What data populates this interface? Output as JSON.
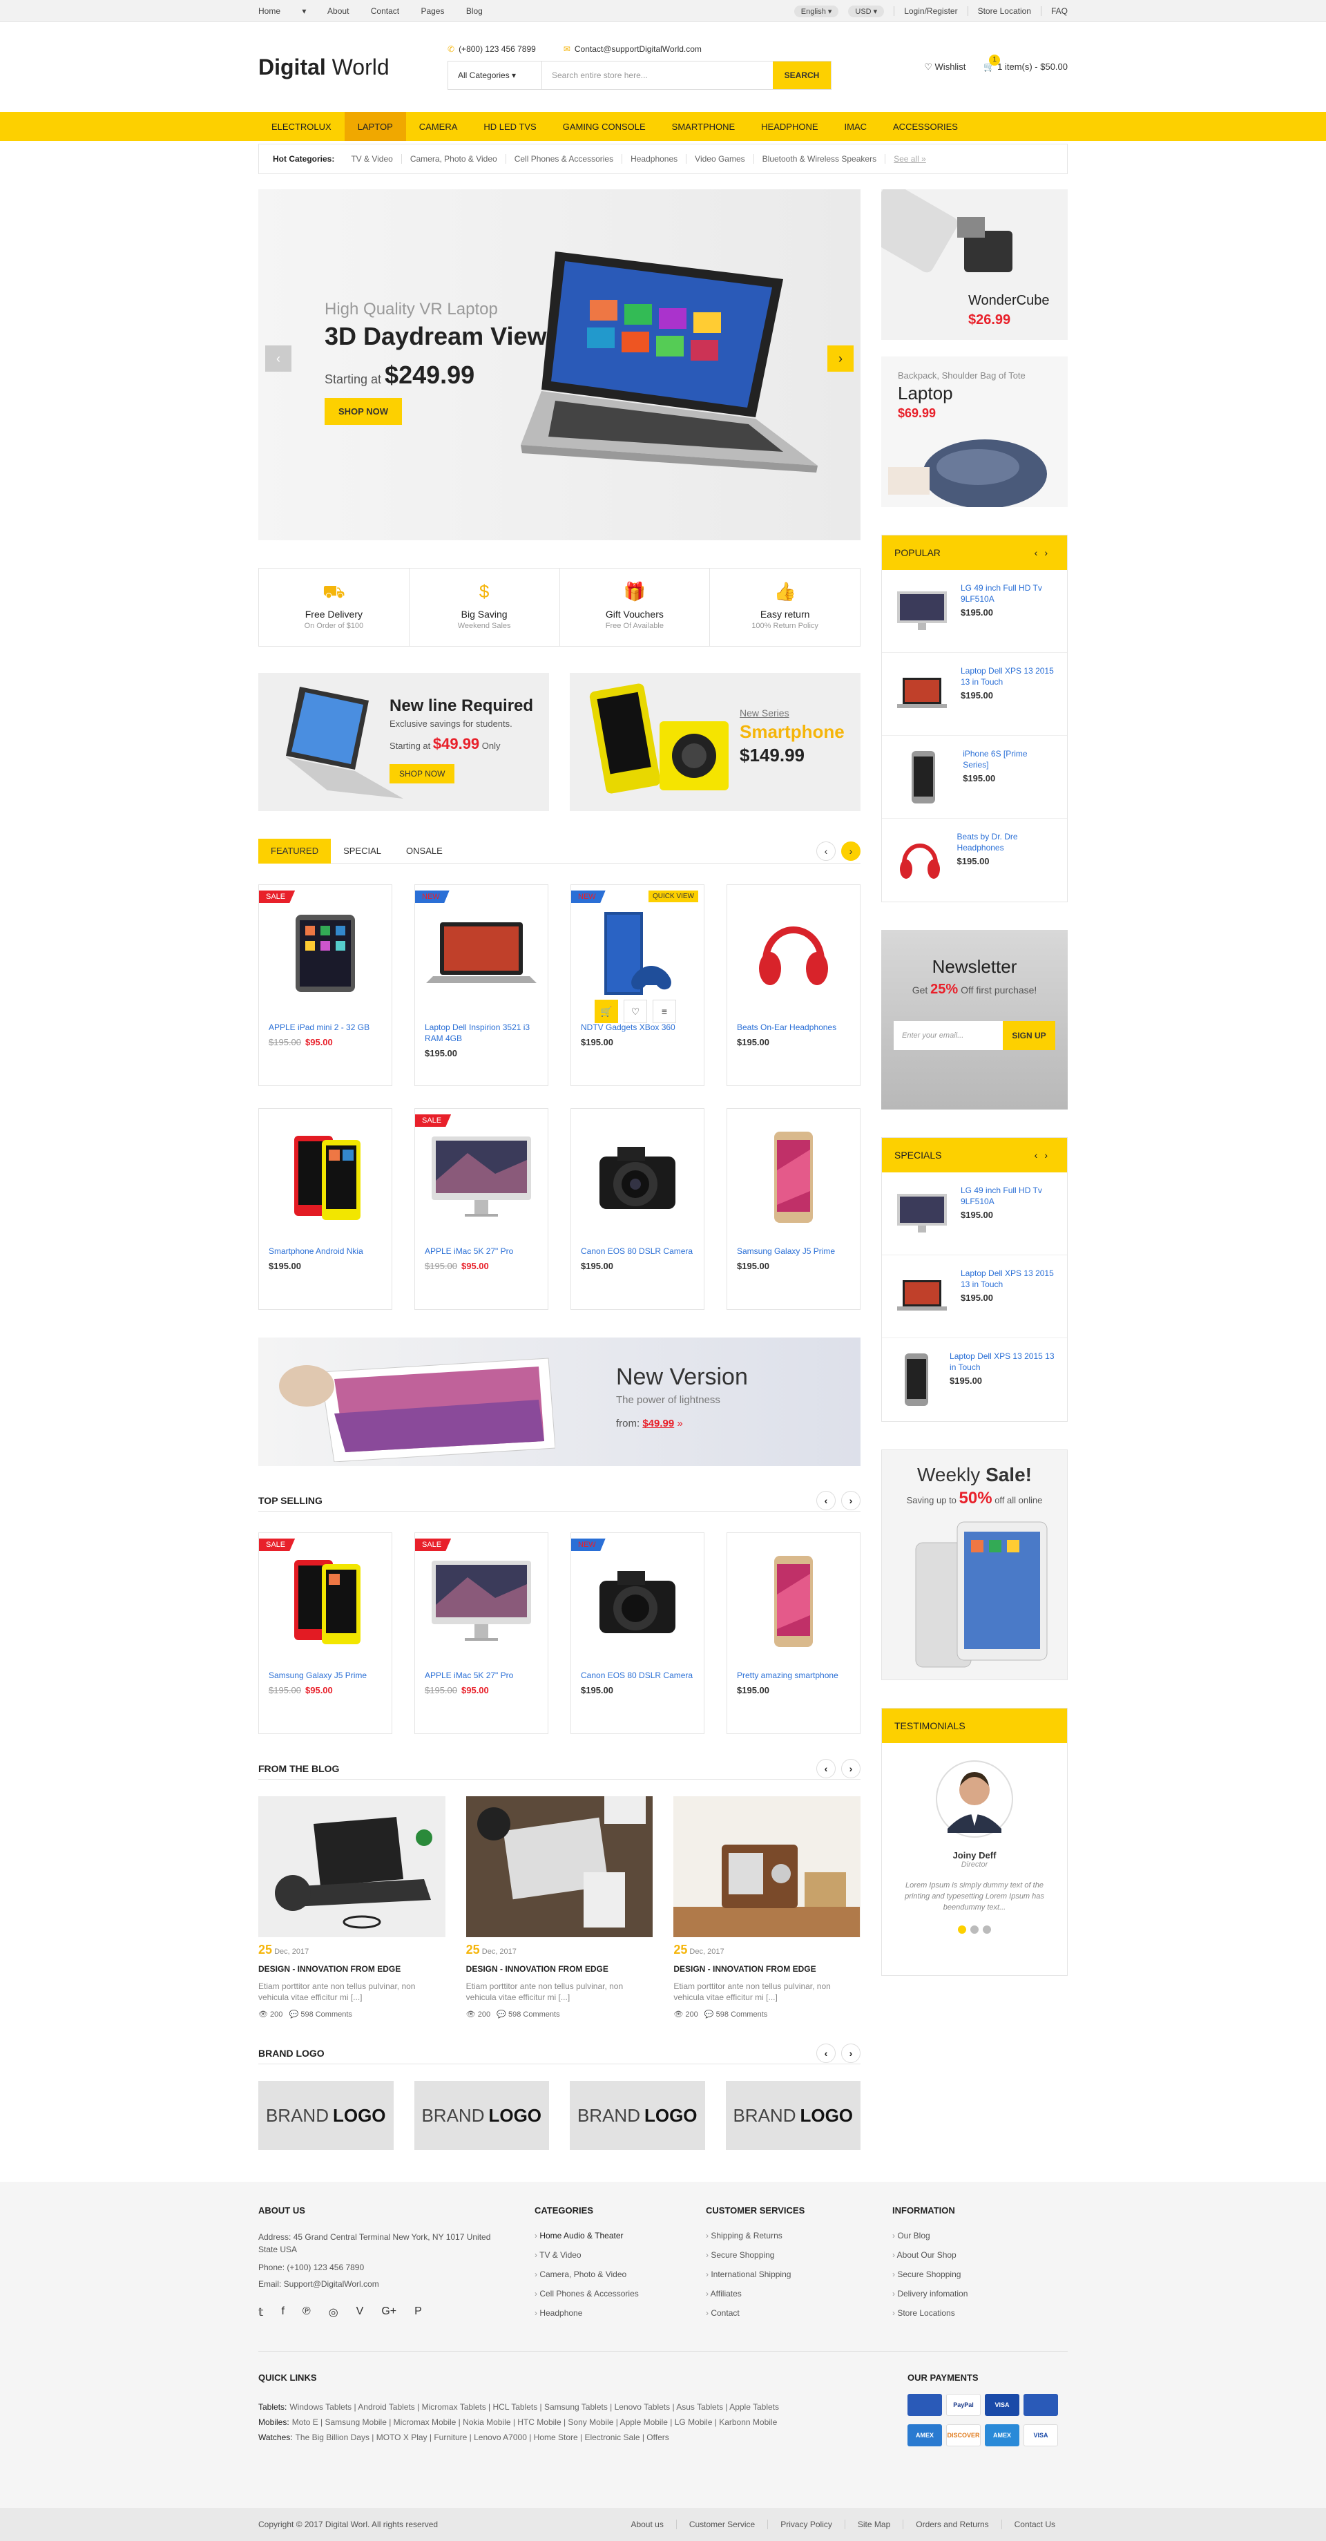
{
  "topbar": {
    "home": "Home",
    "about": "About",
    "contact": "Contact",
    "pages": "Pages",
    "blog": "Blog",
    "language": "English",
    "currency": "USD",
    "login": "Login/Register",
    "store": "Store Location",
    "faq": "FAQ"
  },
  "header": {
    "logo_bold": "Digital",
    "logo_light": " World",
    "phone": "(+800) 123 456 7899",
    "email": "Contact@supportDigitalWorld.com",
    "category": "All Categories",
    "search_placeholder": "Search entire store here...",
    "search_button": "SEARCH",
    "wishlist": "Wishlist",
    "cart_count": "1",
    "cart": "1 item(s) - $50.00"
  },
  "nav": [
    "ELECTROLUX",
    "LAPTOP",
    "CAMERA",
    "HD LED TVS",
    "GAMING CONSOLE",
    "SMARTPHONE",
    "HEADPHONE",
    "IMAC",
    "ACCESSORIES"
  ],
  "hot": {
    "label": "Hot Categories:",
    "items": [
      "TV & Video",
      "Camera, Photo & Video",
      "Cell Phones & Accessories",
      "Headphones",
      "Video Games",
      "Bluetooth & Wireless Speakers"
    ],
    "more": "See all »"
  },
  "slider": {
    "sub": "High Quality VR Laptop",
    "title": "3D Daydream View",
    "starting": "Starting at ",
    "price": "$249.99",
    "button": "SHOP NOW"
  },
  "side": {
    "b1_name": "WonderCube",
    "b1_price": "$26.99",
    "b2_sub": "Backpack, Shoulder Bag of Tote",
    "b2_name": "Laptop",
    "b2_price": "$69.99"
  },
  "features": [
    {
      "t": "Free Delivery",
      "s": "On Order of $100"
    },
    {
      "t": "Big Saving",
      "s": "Weekend Sales"
    },
    {
      "t": "Gift Vouchers",
      "s": "Free Of Available"
    },
    {
      "t": "Easy return",
      "s": "100% Return Policy"
    }
  ],
  "promo1": {
    "title": "New line Required",
    "sub": "Exclusive savings for students.",
    "starting": "Starting at ",
    "price": "$49.99",
    "only": " Only",
    "button": "SHOP NOW"
  },
  "promo2": {
    "sub": "New Series",
    "title": "Smartphone",
    "price": "$149.99"
  },
  "tabs": [
    "FEATURED",
    "SPECIAL",
    "ONSALE"
  ],
  "products": [
    {
      "tag": "SALE",
      "name": "APPLE iPad mini 2 - 32 GB",
      "old": "$195.00",
      "price": "$95.00"
    },
    {
      "tag": "NEW",
      "name": "Laptop Dell Inspirion 3521 i3 RAM 4GB",
      "old": "",
      "price": "$195.00"
    },
    {
      "tag": "NEW",
      "name": "NDTV Gadgets XBox 360",
      "old": "",
      "price": "$195.00",
      "quick": "QUICK VIEW"
    },
    {
      "tag": "",
      "name": "Beats On-Ear Headphones",
      "old": "",
      "price": "$195.00"
    },
    {
      "tag": "",
      "name": "Smartphone Android Nkia",
      "old": "",
      "price": "$195.00"
    },
    {
      "tag": "SALE",
      "name": "APPLE iMac 5K 27\" Pro",
      "old": "$195.00",
      "price": "$95.00"
    },
    {
      "tag": "",
      "name": "Canon EOS 80 DSLR Camera",
      "old": "",
      "price": "$195.00"
    },
    {
      "tag": "",
      "name": "Samsung Galaxy J5 Prime",
      "old": "",
      "price": "$195.00"
    }
  ],
  "wide": {
    "title": "New Version",
    "sub": "The power of lightness",
    "from": "from: ",
    "price": "$49.99"
  },
  "top_selling": {
    "title": "TOP SELLING",
    "items": [
      {
        "tag": "SALE",
        "name": "Samsung Galaxy J5 Prime",
        "old": "$195.00",
        "price": "$95.00"
      },
      {
        "tag": "SALE",
        "name": "APPLE iMac 5K 27\" Pro",
        "old": "$195.00",
        "price": "$95.00"
      },
      {
        "tag": "NEW",
        "name": "Canon EOS 80 DSLR Camera",
        "old": "",
        "price": "$195.00"
      },
      {
        "tag": "",
        "name": "Pretty amazing smartphone",
        "old": "",
        "price": "$195.00"
      }
    ]
  },
  "blog": {
    "title": "FROM THE BLOG",
    "posts": [
      {
        "day": "25",
        "mon": " Dec, 2017",
        "title": "DESIGN - INNOVATION FROM EDGE",
        "text": "Etiam porttitor ante non tellus pulvinar, non vehicula vitae efficitur mi [...]",
        "views": "200",
        "comments": "598 Comments"
      },
      {
        "day": "25",
        "mon": " Dec, 2017",
        "title": "DESIGN - INNOVATION FROM EDGE",
        "text": "Etiam porttitor ante non tellus pulvinar, non vehicula vitae efficitur mi [...]",
        "views": "200",
        "comments": "598 Comments"
      },
      {
        "day": "25",
        "mon": " Dec, 2017",
        "title": "DESIGN - INNOVATION FROM EDGE",
        "text": "Etiam porttitor ante non tellus pulvinar, non vehicula vitae efficitur mi [...]",
        "views": "200",
        "comments": "598 Comments"
      }
    ]
  },
  "brand": {
    "title": "BRAND LOGO",
    "a": "BRAND",
    "b": "LOGO"
  },
  "popular": {
    "title": "POPULAR",
    "items": [
      {
        "name": "LG 49 inch Full HD Tv 9LF510A",
        "price": "$195.00"
      },
      {
        "name": "Laptop Dell XPS 13 2015 13 in Touch",
        "price": "$195.00"
      },
      {
        "name": "iPhone 6S [Prime Series]",
        "price": "$195.00"
      },
      {
        "name": "Beats by Dr. Dre Headphones",
        "price": "$195.00"
      }
    ]
  },
  "newsletter": {
    "title": "Newsletter",
    "get": "Get ",
    "pct": "25%",
    "off": " Off first purchase!",
    "placeholder": "Enter your email...",
    "button": "SIGN UP"
  },
  "specials": {
    "title": "SPECIALS",
    "items": [
      {
        "name": "LG 49 inch Full HD Tv 9LF510A",
        "price": "$195.00"
      },
      {
        "name": "Laptop Dell XPS 13 2015 13 in Touch",
        "price": "$195.00"
      },
      {
        "name": "Laptop Dell XPS 13 2015 13 in Touch",
        "price": "$195.00"
      }
    ]
  },
  "weekly": {
    "a": "Weekly ",
    "b": "Sale!",
    "save": "Saving up to ",
    "pct": "50%",
    "rest": " off all online"
  },
  "testimonials": {
    "title": "TESTIMONIALS",
    "name": "Joiny Deff",
    "role": "Director",
    "text": "Lorem Ipsum is simply dummy text of the printing and typesetting Lorem Ipsum has beendummy text..."
  },
  "footer": {
    "about_title": "ABOUT US",
    "addr_l": "Address:",
    "addr": " 45 Grand Central Terminal New York, NY 1017 United State USA",
    "phone_l": "Phone:",
    "phone": " (+100) 123 456 7890",
    "email_l": "Email:",
    "email": " Support@DigitalWorl.com",
    "cat_title": "CATEGORIES",
    "cats": [
      "Home Audio & Theater",
      "TV & Video",
      "Camera, Photo & Video",
      "Cell Phones & Accessories",
      "Headphone"
    ],
    "cs_title": "CUSTOMER SERVICES",
    "cs": [
      "Shipping & Returns",
      "Secure Shopping",
      "International Shipping",
      "Affiliates",
      "Contact"
    ],
    "info_title": "INFORMATION",
    "info": [
      "Our Blog",
      "About Our Shop",
      "Secure Shopping",
      "Delivery infomation",
      "Store Locations"
    ],
    "ql_title": "QUICK LINKS",
    "tablets_l": "Tablets:",
    "tablets": "Windows Tablets | Android Tablets | Micromax Tablets | HCL Tablets | Samsung Tablets | Lenovo Tablets | Asus Tablets | Apple Tablets",
    "mobiles_l": "Mobiles:",
    "mobiles": "Moto E | Samsung Mobile | Micromax Mobile | Nokia Mobile | HTC Mobile | Sony Mobile | Apple Mobile | LG Mobile | Karbonn Mobile",
    "watches_l": "Watches:",
    "watches": "The Big Billion Days | MOTO X Play | Furniture | Lenovo A7000 | Home Store | Electronic Sale | Offers",
    "pay_title": "OUR PAYMENTS",
    "pays": [
      "",
      "PayPal",
      "VISA",
      "",
      "AMEX",
      "DISCOVER",
      "AMEX",
      "VISA"
    ],
    "copyright": "Copyright © 2017 Digital Worl. All rights reserved",
    "bottom": [
      "About us",
      "Customer Service",
      "Privacy Policy",
      "Site Map",
      "Orders and Returns",
      "Contact Us"
    ]
  }
}
